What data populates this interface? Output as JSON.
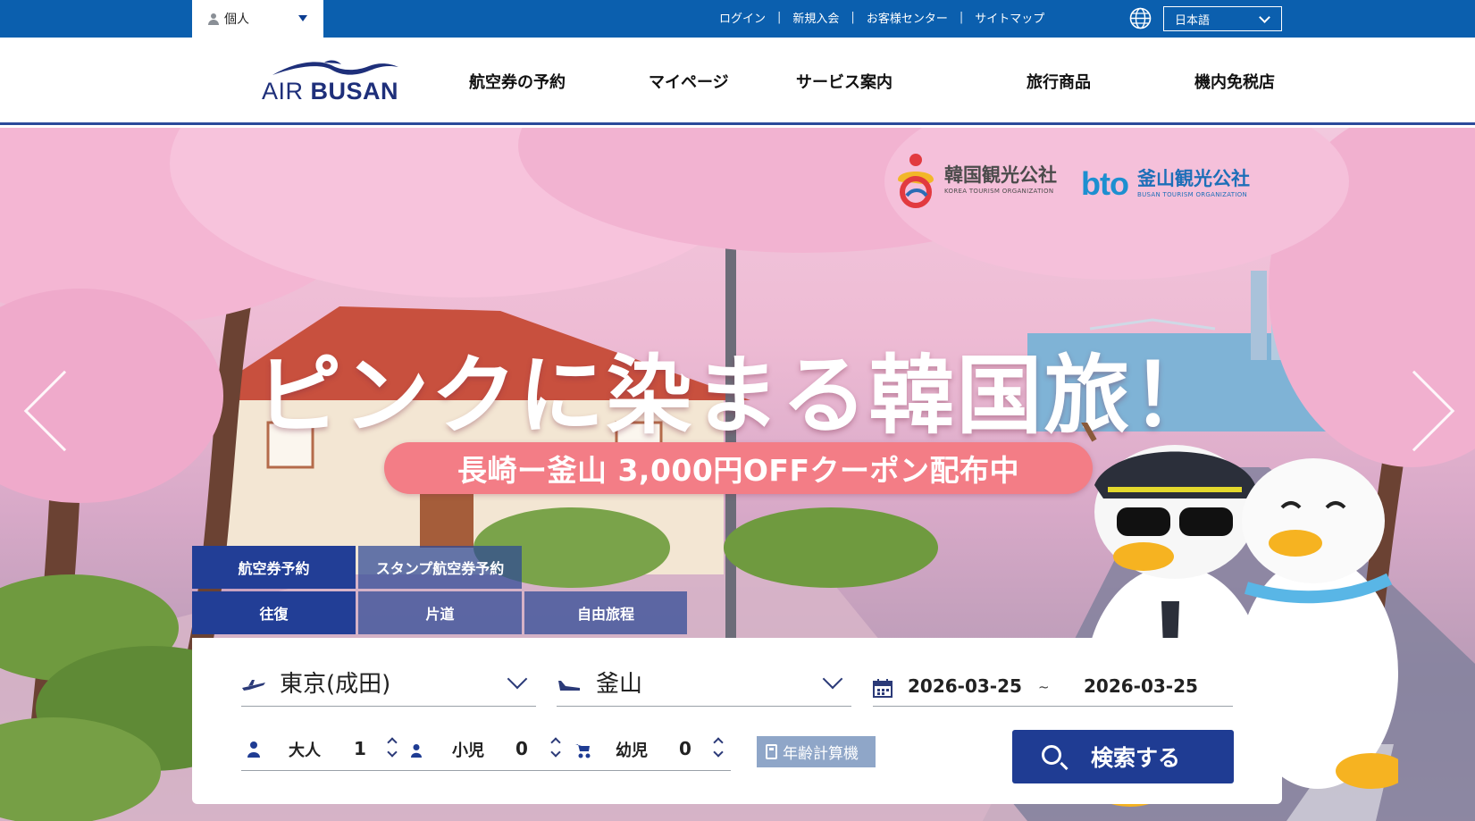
{
  "topbar": {
    "member_type": "個人",
    "links": [
      "ログイン",
      "新規入会",
      "お客様センター",
      "サイトマップ"
    ],
    "language": "日本語",
    "icons": {
      "member": "person-icon",
      "language": "globe-icon"
    }
  },
  "header": {
    "logo_prefix": "AIR",
    "logo_main": "BUSAN",
    "nav": [
      "航空券の予約",
      "マイページ",
      "サービス案内",
      "旅行商品",
      "機内免税店"
    ]
  },
  "hero": {
    "headline": "ピンクに染まる韓国旅！",
    "coupon": "長崎ー釜山 3,000円OFFクーポン配布中",
    "partners": [
      {
        "name": "韓国観光公社",
        "sub": "KOREA TOURISM ORGANIZATION"
      },
      {
        "name": "釜山観光公社",
        "sub": "BUSAN TOURISM ORGANIZATION"
      }
    ],
    "partner_logo_text": "bto"
  },
  "booking": {
    "tabs_top": [
      "航空券予約",
      "スタンプ航空券予約"
    ],
    "trip_types": [
      "往復",
      "片道",
      "自由旅程"
    ],
    "origin": "東京(成田)",
    "destination": "釜山",
    "depart_date": "2026-03-25",
    "date_separator": "~",
    "return_date": "2026-03-25",
    "passengers": [
      {
        "label": "大人",
        "count": "1"
      },
      {
        "label": "小児",
        "count": "0"
      },
      {
        "label": "幼児",
        "count": "0"
      }
    ],
    "age_calculator": "年齢計算機",
    "search": "検索する"
  },
  "colors": {
    "topbar": "#0b5fae",
    "brand_navy": "#1f3c93",
    "coupon_pill": "#f37d86",
    "age_button": "#8fa6c8"
  }
}
